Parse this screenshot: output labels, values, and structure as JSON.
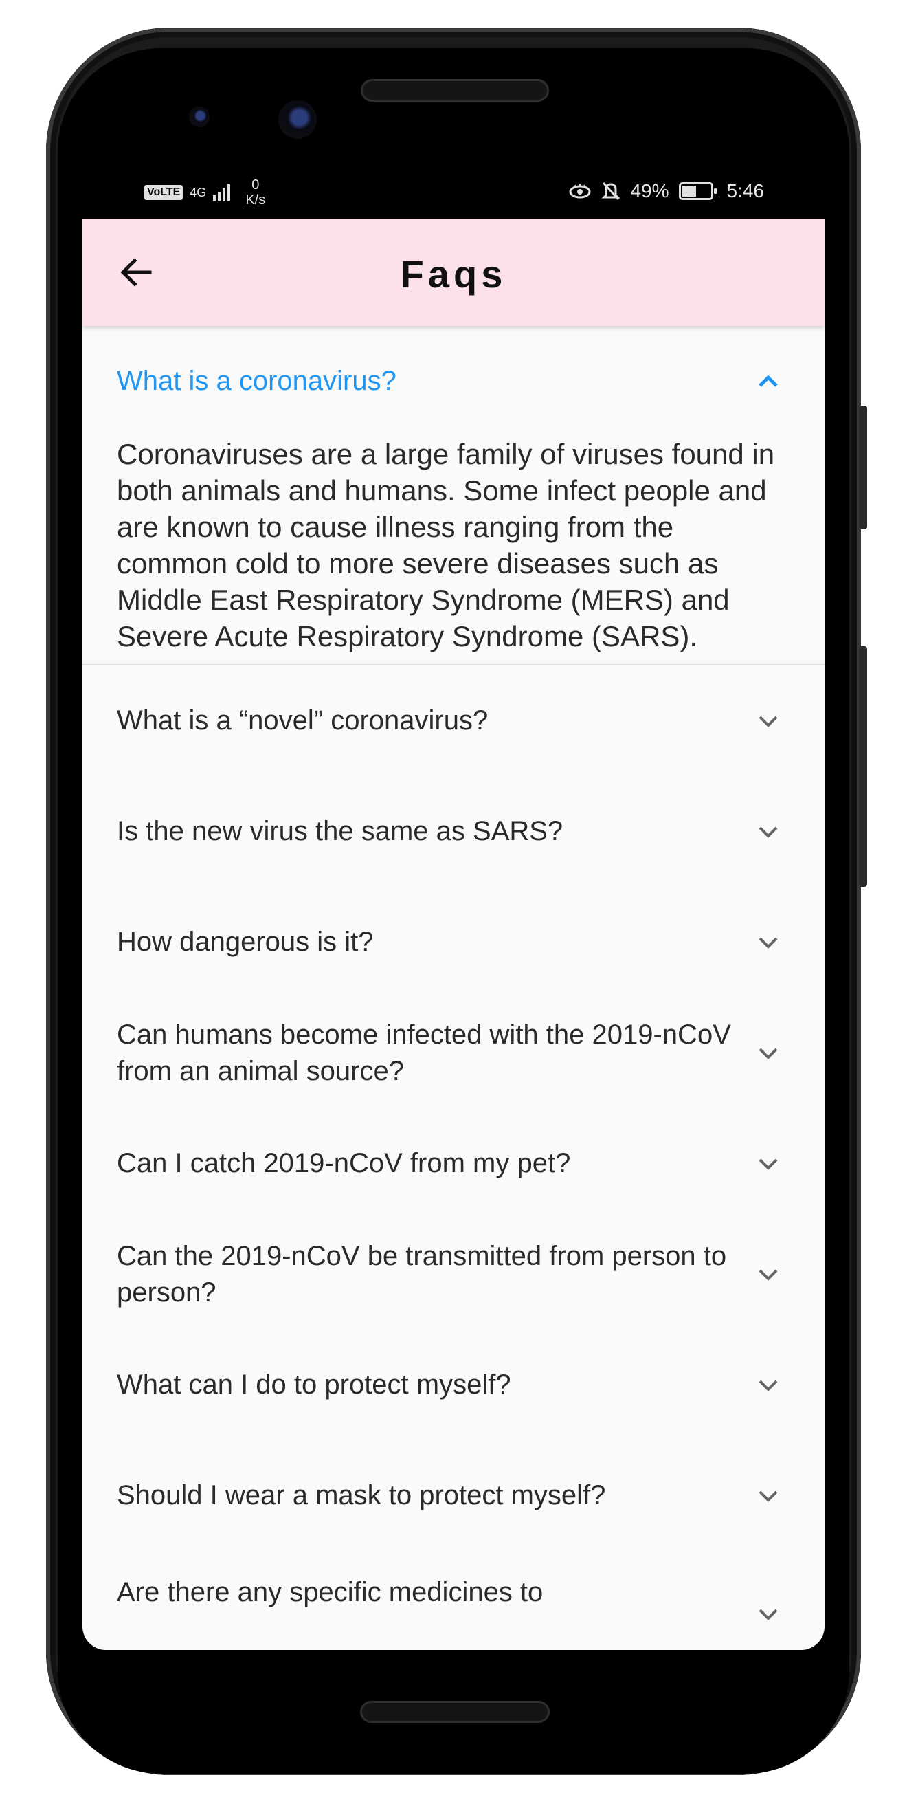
{
  "status_bar": {
    "network": "VoLTE",
    "signal_type": "4G",
    "speed_value": "0",
    "speed_unit": "K/s",
    "battery": "49%",
    "battery_level": 0.49,
    "time": "5:46"
  },
  "app_bar": {
    "title": "Faqs",
    "back_icon": "arrow-left-icon"
  },
  "colors": {
    "app_bar_bg": "#fde1e9",
    "accent": "#2196f3",
    "text": "#2a2a2a",
    "background": "#fafafa"
  },
  "faqs": [
    {
      "question": "What is a coronavirus?",
      "expanded": true,
      "answer": "Coronaviruses are a large family of viruses found in  both animals and humans. Some infect people and are known to cause illness ranging from the common cold to more severe diseases such as Middle East Respiratory Syndrome (MERS) and Severe Acute Respiratory Syndrome (SARS)."
    },
    {
      "question": "What is a “novel” coronavirus?",
      "expanded": false
    },
    {
      "question": "Is the new virus the same as SARS?",
      "expanded": false
    },
    {
      "question": "How dangerous is it?",
      "expanded": false
    },
    {
      "question": "Can humans become infected with the 2019-nCoV from an animal source?",
      "expanded": false
    },
    {
      "question": "Can I catch 2019-nCoV from my pet?",
      "expanded": false
    },
    {
      "question": "Can the 2019-nCoV be transmitted from person to person?",
      "expanded": false
    },
    {
      "question": "What can I do to protect myself?",
      "expanded": false
    },
    {
      "question": "Should I wear a mask to protect myself?",
      "expanded": false
    },
    {
      "question": "Are there any specific medicines to",
      "expanded": false
    }
  ]
}
